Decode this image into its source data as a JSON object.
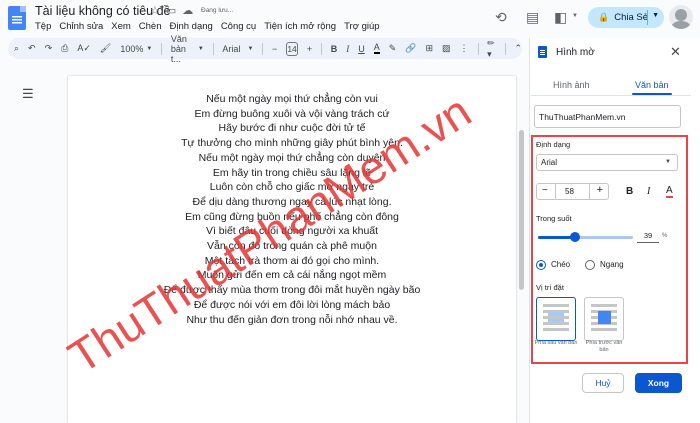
{
  "document": {
    "title": "Tài liệu không có tiêu đề",
    "status": "Đang lưu...",
    "menu": [
      "Tệp",
      "Chỉnh sửa",
      "Xem",
      "Chèn",
      "Định dạng",
      "Công cụ",
      "Tiện ích mở rộng",
      "Trợ giúp"
    ],
    "share_label": "Chia Sẻ"
  },
  "toolbar": {
    "zoom": "100%",
    "style": "Văn bản t...",
    "font": "Arial",
    "font_size": "14"
  },
  "poem": [
    "Nếu một ngày mọi thứ chẳng còn vui",
    "Em đừng buông xuôi và vội vàng trách cứ",
    "Hãy bước đi như cuộc đời tử tế",
    "Tự thưởng cho mình những giây phút bình yên.",
    "Nếu một ngày mọi thứ chẳng còn duyên",
    "Em hãy tin trong chiều sâu lặng lẽ",
    "Luôn còn chỗ cho giấc mơ ngày trẻ",
    "Để dịu dàng thương ngay cả lúc nhạt lòng.",
    "Em cũng đừng buồn nếu phố chẳng còn đông",
    "Vì biết đâu cuối dòng người xa khuất",
    "Vẫn còn đó trong quán cà phê muộn",
    "Một tách trà thơm ai đó gọi cho mình.",
    "Muốn gửi đến em cả cái nắng ngọt mềm",
    "Để được thấy mùa thơm trong đôi mắt huyền ngày bão",
    "Để được nói với em đôi lời lòng mách bảo",
    "Như thu đến giản đơn trong nỗi nhớ nhau về."
  ],
  "watermark": {
    "text": "ThuThuatPhanMem.vn",
    "color": "#e63434"
  },
  "panel": {
    "title": "Hình mờ",
    "tabs": [
      "Hình ảnh",
      "Văn bản"
    ],
    "active_tab": "Văn bản",
    "text_value": "ThuThuatPhanMem.vn",
    "format_label": "Định dạng",
    "font": "Arial",
    "font_size": "58",
    "opacity_label": "Trong suốt",
    "opacity_value": "39",
    "opacity_unit": "%",
    "orientation": [
      "Chéo",
      "Ngang"
    ],
    "selected_orientation": "Chéo",
    "position_label": "Vị trí đặt",
    "positions": [
      "Phía sau văn bản",
      "Phía trước văn bản"
    ],
    "cancel_label": "Huỷ",
    "ok_label": "Xong"
  },
  "colors": {
    "accent": "#0b57d0",
    "share_bg": "#c2e7ff",
    "highlight_border": "#e8444a"
  }
}
